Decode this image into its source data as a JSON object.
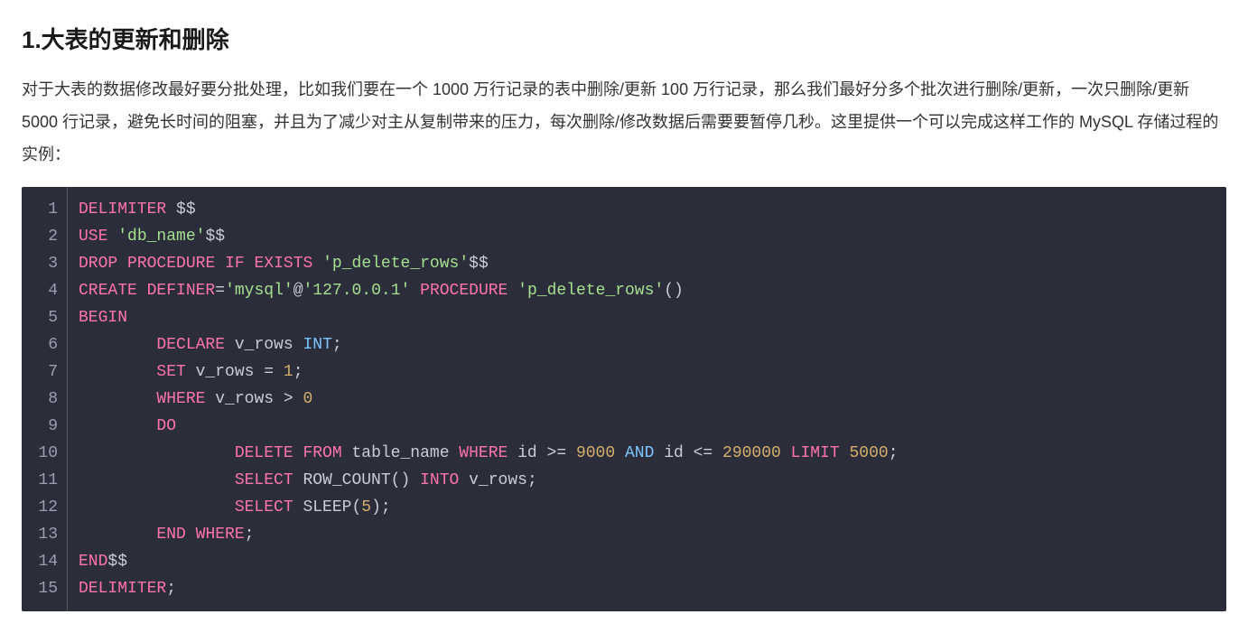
{
  "heading": "1.大表的更新和删除",
  "paragraph": "对于大表的数据修改最好要分批处理，比如我们要在一个 1000 万行记录的表中删除/更新 100 万行记录，那么我们最好分多个批次进行删除/更新，一次只删除/更新 5000 行记录，避免长时间的阻塞，并且为了减少对主从复制带来的压力，每次删除/修改数据后需要要暂停几秒。这里提供一个可以完成这样工作的 MySQL 存储过程的实例：",
  "code": {
    "line_numbers": [
      "1",
      "2",
      "3",
      "4",
      "5",
      "6",
      "7",
      "8",
      "9",
      "10",
      "11",
      "12",
      "13",
      "14",
      "15"
    ],
    "tokens_per_line": [
      [
        {
          "c": "tok-kw",
          "t": "DELIMITER"
        },
        {
          "c": "tok-ident",
          "t": " $$"
        }
      ],
      [
        {
          "c": "tok-kw",
          "t": "USE"
        },
        {
          "c": "tok-ident",
          "t": " "
        },
        {
          "c": "tok-str",
          "t": "'db_name'"
        },
        {
          "c": "tok-ident",
          "t": "$$"
        }
      ],
      [
        {
          "c": "tok-kw",
          "t": "DROP"
        },
        {
          "c": "tok-ident",
          "t": " "
        },
        {
          "c": "tok-kw",
          "t": "PROCEDURE"
        },
        {
          "c": "tok-ident",
          "t": " "
        },
        {
          "c": "tok-kw",
          "t": "IF"
        },
        {
          "c": "tok-ident",
          "t": " "
        },
        {
          "c": "tok-kw",
          "t": "EXISTS"
        },
        {
          "c": "tok-ident",
          "t": " "
        },
        {
          "c": "tok-str",
          "t": "'p_delete_rows'"
        },
        {
          "c": "tok-ident",
          "t": "$$"
        }
      ],
      [
        {
          "c": "tok-kw",
          "t": "CREATE"
        },
        {
          "c": "tok-ident",
          "t": " "
        },
        {
          "c": "tok-kw",
          "t": "DEFINER"
        },
        {
          "c": "tok-op",
          "t": "="
        },
        {
          "c": "tok-str",
          "t": "'mysql'"
        },
        {
          "c": "tok-ident",
          "t": "@"
        },
        {
          "c": "tok-str",
          "t": "'127.0.0.1'"
        },
        {
          "c": "tok-ident",
          "t": " "
        },
        {
          "c": "tok-kw",
          "t": "PROCEDURE"
        },
        {
          "c": "tok-ident",
          "t": " "
        },
        {
          "c": "tok-str",
          "t": "'p_delete_rows'"
        },
        {
          "c": "tok-punc",
          "t": "()"
        }
      ],
      [
        {
          "c": "tok-kw",
          "t": "BEGIN"
        }
      ],
      [
        {
          "c": "tok-ident",
          "t": "        "
        },
        {
          "c": "tok-kw",
          "t": "DECLARE"
        },
        {
          "c": "tok-ident",
          "t": " v_rows "
        },
        {
          "c": "tok-type",
          "t": "INT"
        },
        {
          "c": "tok-punc",
          "t": ";"
        }
      ],
      [
        {
          "c": "tok-ident",
          "t": "        "
        },
        {
          "c": "tok-kw",
          "t": "SET"
        },
        {
          "c": "tok-ident",
          "t": " v_rows "
        },
        {
          "c": "tok-op",
          "t": "="
        },
        {
          "c": "tok-ident",
          "t": " "
        },
        {
          "c": "tok-num",
          "t": "1"
        },
        {
          "c": "tok-punc",
          "t": ";"
        }
      ],
      [
        {
          "c": "tok-ident",
          "t": "        "
        },
        {
          "c": "tok-kw",
          "t": "WHERE"
        },
        {
          "c": "tok-ident",
          "t": " v_rows "
        },
        {
          "c": "tok-op",
          "t": ">"
        },
        {
          "c": "tok-ident",
          "t": " "
        },
        {
          "c": "tok-num",
          "t": "0"
        }
      ],
      [
        {
          "c": "tok-ident",
          "t": "        "
        },
        {
          "c": "tok-kw",
          "t": "DO"
        }
      ],
      [
        {
          "c": "tok-ident",
          "t": "                "
        },
        {
          "c": "tok-kw",
          "t": "DELETE"
        },
        {
          "c": "tok-ident",
          "t": " "
        },
        {
          "c": "tok-kw",
          "t": "FROM"
        },
        {
          "c": "tok-ident",
          "t": " table_name "
        },
        {
          "c": "tok-kw",
          "t": "WHERE"
        },
        {
          "c": "tok-ident",
          "t": " id "
        },
        {
          "c": "tok-op",
          "t": ">="
        },
        {
          "c": "tok-ident",
          "t": " "
        },
        {
          "c": "tok-num",
          "t": "9000"
        },
        {
          "c": "tok-ident",
          "t": " "
        },
        {
          "c": "tok-type",
          "t": "AND"
        },
        {
          "c": "tok-ident",
          "t": " id "
        },
        {
          "c": "tok-op",
          "t": "<="
        },
        {
          "c": "tok-ident",
          "t": " "
        },
        {
          "c": "tok-num",
          "t": "290000"
        },
        {
          "c": "tok-ident",
          "t": " "
        },
        {
          "c": "tok-kw",
          "t": "LIMIT"
        },
        {
          "c": "tok-ident",
          "t": " "
        },
        {
          "c": "tok-num",
          "t": "5000"
        },
        {
          "c": "tok-punc",
          "t": ";"
        }
      ],
      [
        {
          "c": "tok-ident",
          "t": "                "
        },
        {
          "c": "tok-kw",
          "t": "SELECT"
        },
        {
          "c": "tok-ident",
          "t": " ROW_COUNT"
        },
        {
          "c": "tok-punc",
          "t": "()"
        },
        {
          "c": "tok-ident",
          "t": " "
        },
        {
          "c": "tok-kw",
          "t": "INTO"
        },
        {
          "c": "tok-ident",
          "t": " v_rows"
        },
        {
          "c": "tok-punc",
          "t": ";"
        }
      ],
      [
        {
          "c": "tok-ident",
          "t": "                "
        },
        {
          "c": "tok-kw",
          "t": "SELECT"
        },
        {
          "c": "tok-ident",
          "t": " SLEEP"
        },
        {
          "c": "tok-punc",
          "t": "("
        },
        {
          "c": "tok-num",
          "t": "5"
        },
        {
          "c": "tok-punc",
          "t": ")"
        },
        {
          "c": "tok-punc",
          "t": ";"
        }
      ],
      [
        {
          "c": "tok-ident",
          "t": "        "
        },
        {
          "c": "tok-kw",
          "t": "END"
        },
        {
          "c": "tok-ident",
          "t": " "
        },
        {
          "c": "tok-kw",
          "t": "WHERE"
        },
        {
          "c": "tok-punc",
          "t": ";"
        }
      ],
      [
        {
          "c": "tok-kw",
          "t": "END"
        },
        {
          "c": "tok-ident",
          "t": "$$"
        }
      ],
      [
        {
          "c": "tok-kw",
          "t": "DELIMITER"
        },
        {
          "c": "tok-punc",
          "t": ";"
        }
      ]
    ]
  }
}
